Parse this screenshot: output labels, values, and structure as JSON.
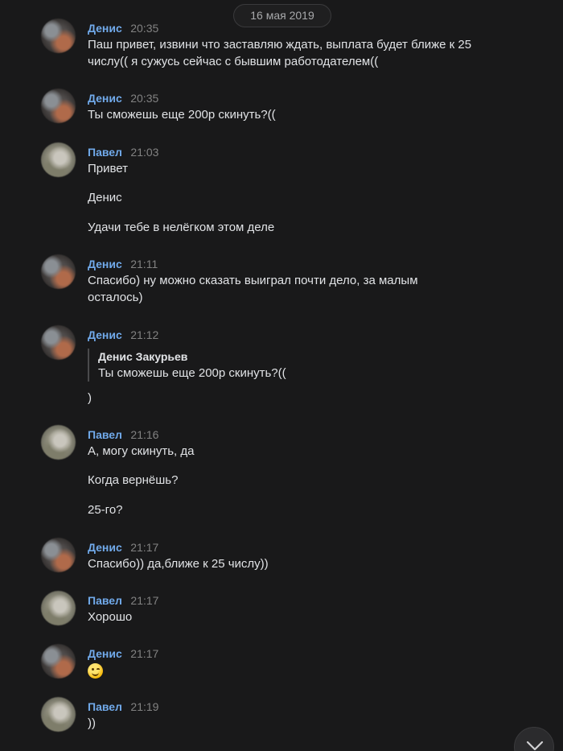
{
  "date_divider": "16 мая 2019",
  "messages": [
    {
      "author": "Денис",
      "time": "20:35",
      "lines": [
        "Паш привет, извини что заставляю ждать, выплата будет ближе к 25 числу(( я сужусь сейчас с бывшим работодателем(("
      ]
    },
    {
      "author": "Денис",
      "time": "20:35",
      "lines": [
        "Ты сможешь еще 200р скинуть?(("
      ]
    },
    {
      "author": "Павел",
      "time": "21:03",
      "lines": [
        "Привет",
        "Денис",
        "Удачи тебе в нелёгком этом деле"
      ]
    },
    {
      "author": "Денис",
      "time": "21:11",
      "lines": [
        "Спасибо) ну можно сказать выиграл почти дело, за малым осталось)"
      ]
    },
    {
      "author": "Денис",
      "time": "21:12",
      "reply": {
        "author": "Денис Закурьев",
        "text": "Ты сможешь еще 200р скинуть?(("
      },
      "lines": [
        ")"
      ]
    },
    {
      "author": "Павел",
      "time": "21:16",
      "lines": [
        "А, могу скинуть, да",
        "Когда вернёшь?",
        "25-го?"
      ]
    },
    {
      "author": "Денис",
      "time": "21:17",
      "lines": [
        "Спасибо)) да,ближе к 25 числу))"
      ]
    },
    {
      "author": "Павел",
      "time": "21:17",
      "lines": [
        "Хорошо"
      ]
    },
    {
      "author": "Денис",
      "time": "21:17",
      "emoji": "winking-face-emoji"
    },
    {
      "author": "Павел",
      "time": "21:19",
      "lines": [
        "))"
      ]
    }
  ],
  "icons": {
    "scroll_down": "chevron-down-icon",
    "emoji": "winking-face-emoji"
  },
  "colors": {
    "background": "#19191a",
    "author": "#71aaeb",
    "time": "#828282",
    "text": "#e1e3e6"
  }
}
